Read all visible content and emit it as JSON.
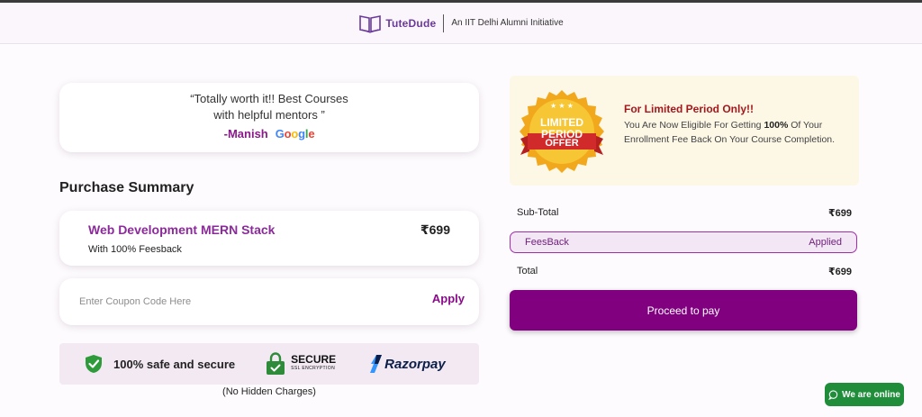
{
  "header": {
    "brand": "TuteDude",
    "tagline": "An IIT Delhi Alumni Initiative"
  },
  "testimonial": {
    "line1": "“Totally worth it!! Best Courses",
    "line2": "with helpful mentors ”",
    "author": "-Manish",
    "source": "Google"
  },
  "purchase_summary": {
    "title": "Purchase Summary",
    "course_name": "Web Development MERN Stack",
    "course_sub": "With 100% Feesback",
    "price": "₹699"
  },
  "coupon": {
    "placeholder": "Enter Coupon Code Here",
    "value": "",
    "apply_label": "Apply"
  },
  "security": {
    "safe_label": "100% safe and secure",
    "ssl_main": "SECURE",
    "ssl_sub": "SSL ENCRYPTION",
    "payment_brand": "Razorpay"
  },
  "no_hidden": "(No Hidden Charges)",
  "offer": {
    "badge_line1": "LIMITED",
    "badge_line2": "PERIOD",
    "badge_line3": "OFFER",
    "title": "For Limited Period Only!!",
    "desc_before": "You Are Now Eligible For Getting ",
    "desc_bold": "100%",
    "desc_after": " Of Your Enrollment Fee Back On Your Course Completion."
  },
  "order": {
    "subtotal_label": "Sub-Total",
    "subtotal_value": "₹699",
    "feesback_label": "FeesBack",
    "feesback_status": "Applied",
    "total_label": "Total",
    "total_value": "₹699",
    "proceed_label": "Proceed to pay"
  },
  "chat": {
    "label": "We are online"
  },
  "colors": {
    "brand_purple": "#800080",
    "accent_magenta": "#8b2a9a",
    "offer_red": "#a3181c",
    "whatsapp_green": "#1f8d3a"
  },
  "icons": [
    "book-logo-icon",
    "google-logo-icon",
    "shield-check-icon",
    "ssl-lock-icon",
    "razorpay-logo-icon",
    "limited-offer-badge-icon",
    "chat-bubble-icon"
  ]
}
